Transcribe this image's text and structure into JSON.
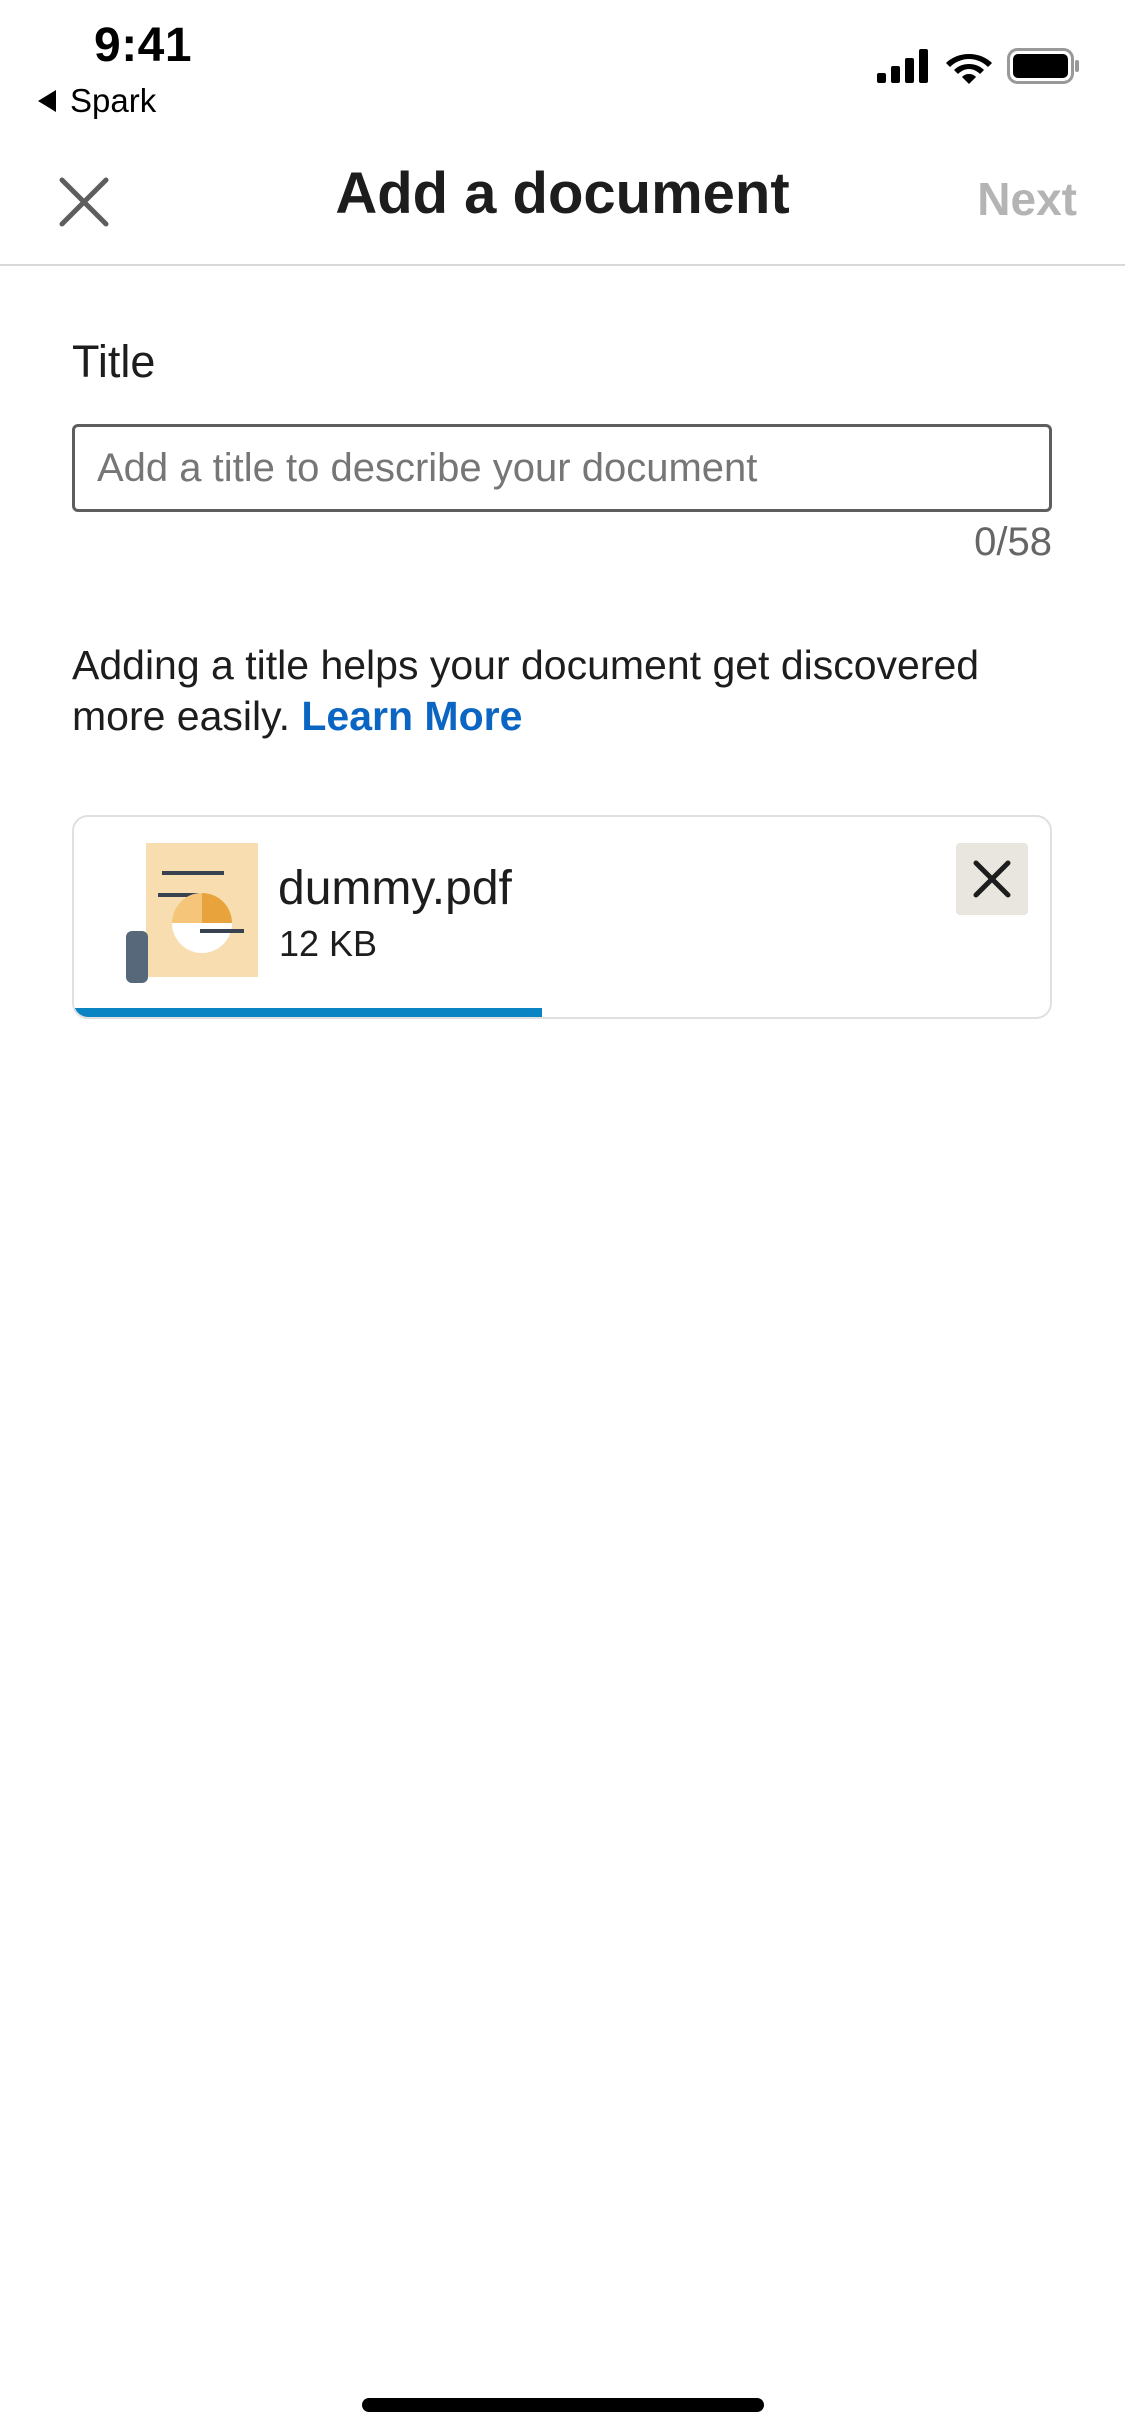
{
  "status_bar": {
    "time": "9:41",
    "back_label": "Spark",
    "icons": [
      "signal-icon",
      "wifi-icon",
      "battery-icon"
    ]
  },
  "nav": {
    "title": "Add a document",
    "next_label": "Next",
    "close_icon": "close-icon"
  },
  "form": {
    "title_label": "Title",
    "title_value": "",
    "title_placeholder": "Add a title to describe your document",
    "char_count": "0/58",
    "helper_text": "Adding a title helps your document get discovered more easily.",
    "learn_more": "Learn More"
  },
  "attachment": {
    "file_name": "dummy.pdf",
    "file_size": "12 KB",
    "upload_progress": 0.48,
    "remove_icon": "close-icon"
  },
  "colors": {
    "accent": "#0a66c2",
    "progress": "#0a84c2",
    "disabled_text": "#b4b4b4"
  }
}
